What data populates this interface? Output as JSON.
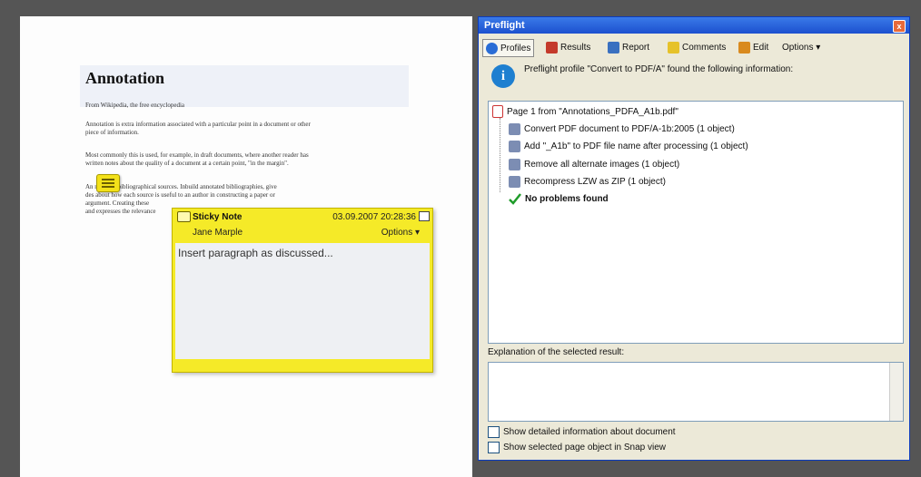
{
  "document": {
    "title": "Annotation",
    "lines": [
      "From Wikipedia, the free encyclopedia",
      "Annotation is extra information associated with a particular point in a document or other",
      "piece of information.",
      "Most commonly this is used, for example, in draft documents, where another reader has",
      "written notes about the quality of a document at a certain point, \"in the margin\".",
      "An          ns about bibliographical sources. Inbuild annotated bibliographies, give",
      "des          about how each source is useful to an author in constructing a paper or",
      "argument. Creating these",
      "and expresses the relevance"
    ]
  },
  "sticky_note": {
    "title": "Sticky Note",
    "date": "03.09.2007 20:28:36",
    "author": "Jane Marple",
    "options_label": "Options ▾",
    "text": "Insert paragraph as discussed..."
  },
  "preflight": {
    "window_title": "Preflight",
    "close_label": "x",
    "tabs": [
      {
        "label": "Profiles",
        "icon": "profiles-icon",
        "color": "#2a6dd6"
      },
      {
        "label": "Results",
        "icon": "results-icon",
        "color": "#c43a2b"
      },
      {
        "label": "Report",
        "icon": "report-icon",
        "color": "#3a70c0"
      },
      {
        "label": "Comments",
        "icon": "comments-icon",
        "color": "#e6c22a"
      },
      {
        "label": "Edit",
        "icon": "edit-icon",
        "color": "#d98a1e"
      },
      {
        "label": "Options ▾",
        "icon": "",
        "color": ""
      }
    ],
    "info_text": "Preflight profile \"Convert to PDF/A\" found the following information:",
    "results": [
      {
        "text": "Page 1 from \"Annotations_PDFA_A1b.pdf\"",
        "icon": "page-icon",
        "bold": false
      },
      {
        "text": "Convert PDF document to PDF/A-1b:2005 (1 object)",
        "icon": "fixup-icon",
        "bold": false
      },
      {
        "text": "Add \"_A1b\" to PDF file name after processing (1 object)",
        "icon": "fixup-icon",
        "bold": false
      },
      {
        "text": "Remove all alternate images (1 object)",
        "icon": "fixup-icon",
        "bold": false
      },
      {
        "text": "Recompress LZW as ZIP  (1 object)",
        "icon": "fixup-icon",
        "bold": false
      },
      {
        "text": "No problems found",
        "icon": "checkmark-icon",
        "bold": true
      }
    ],
    "explanation_label": "Explanation of the selected result:",
    "checkboxes": [
      {
        "label": "Show detailed information about document",
        "checked": false
      },
      {
        "label": "Show selected page object in Snap view",
        "checked": false
      }
    ]
  },
  "colors": {
    "titlebar": "#2a63dc",
    "sticky_yellow": "#f5ea28",
    "check_green": "#1f9c2a"
  }
}
